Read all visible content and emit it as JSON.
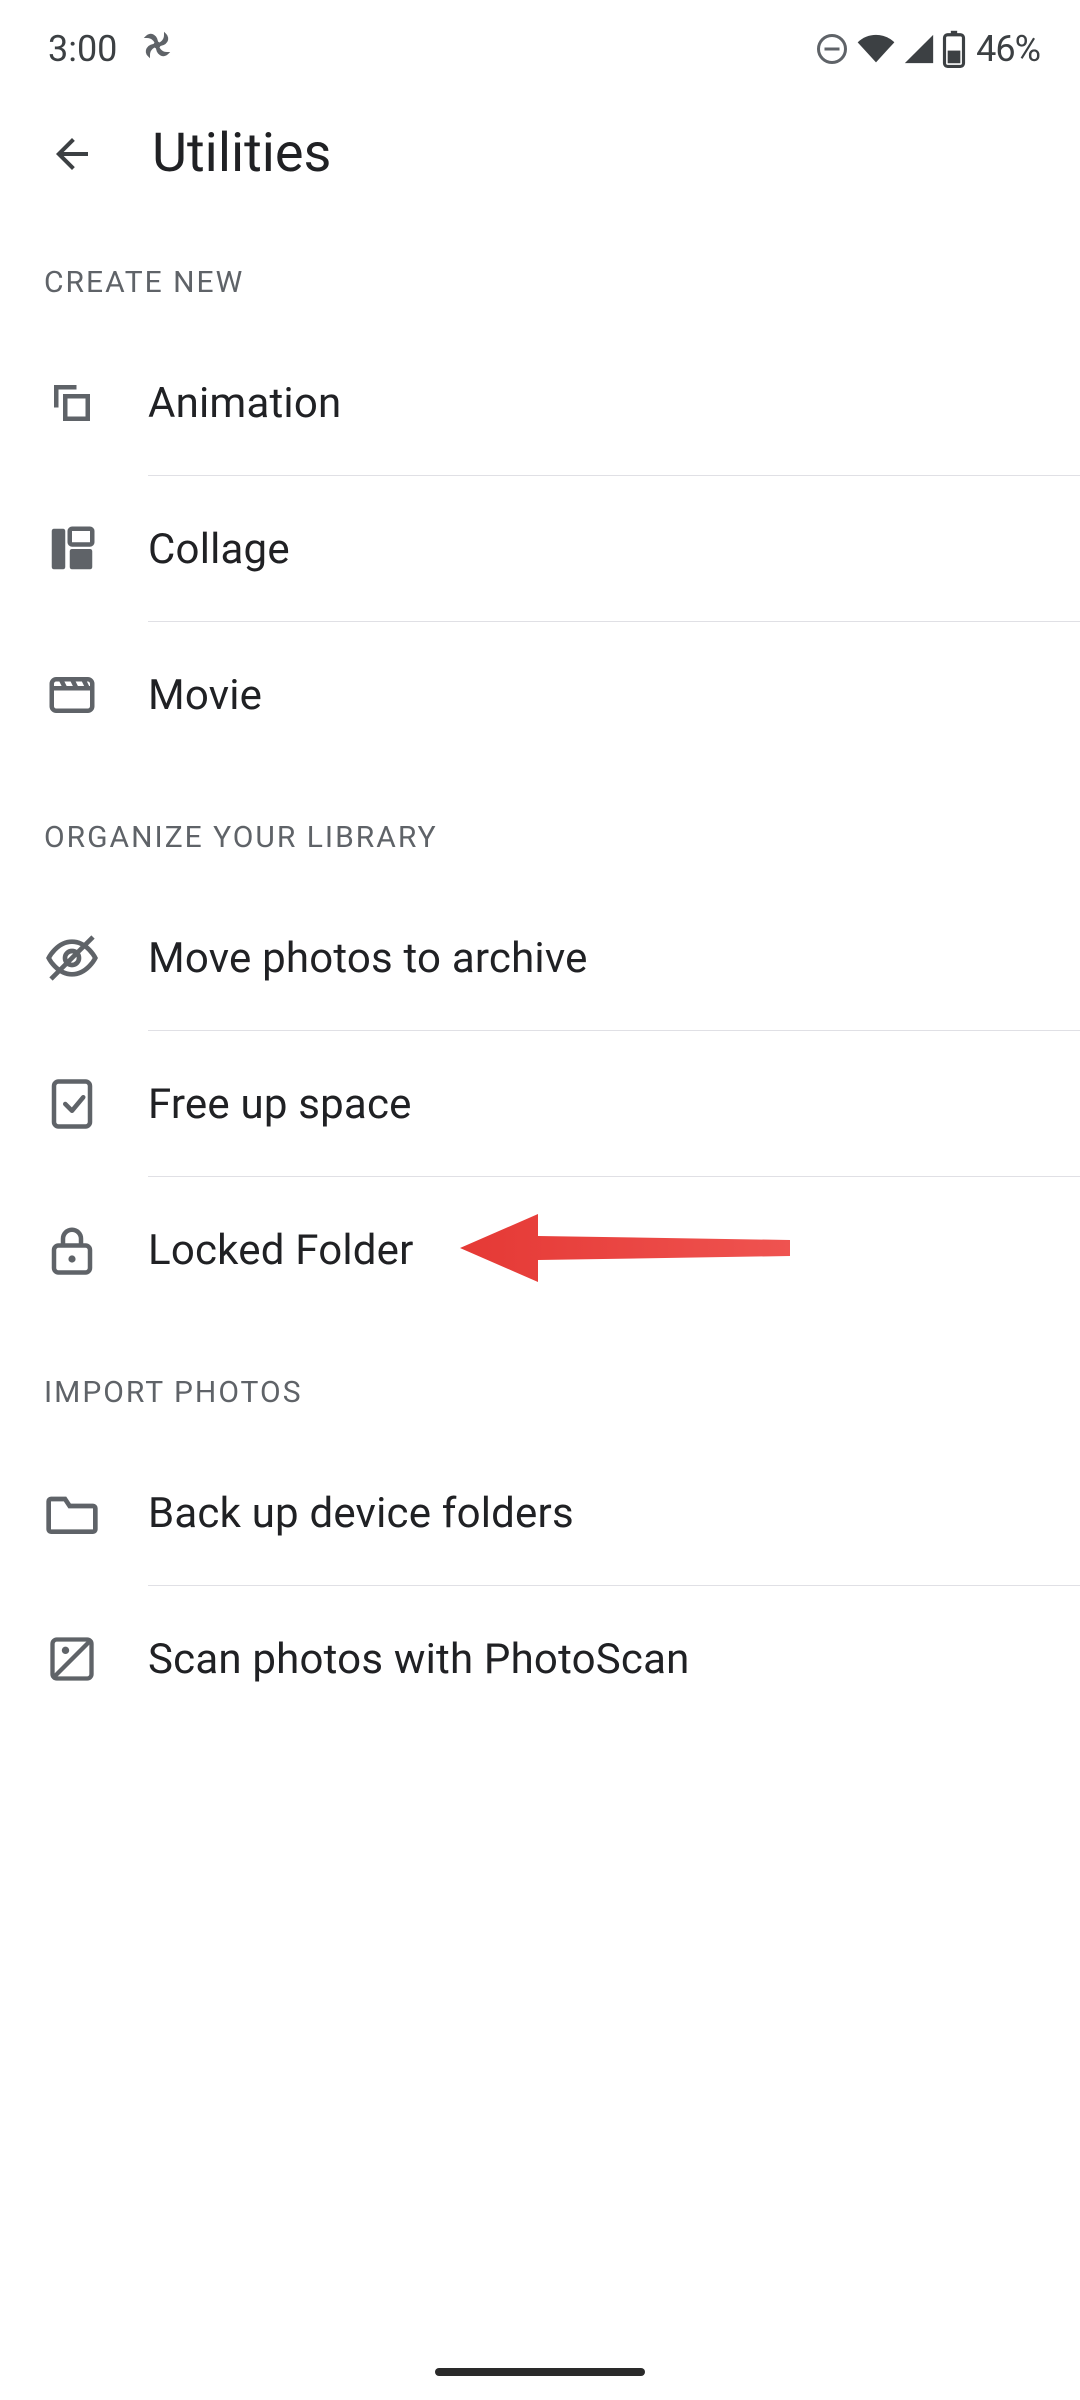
{
  "status": {
    "time": "3:00",
    "battery_pct": "46%"
  },
  "header": {
    "title": "Utilities"
  },
  "sections": {
    "create_new": {
      "title": "CREATE NEW",
      "items": [
        {
          "label": "Animation"
        },
        {
          "label": "Collage"
        },
        {
          "label": "Movie"
        }
      ]
    },
    "organize": {
      "title": "ORGANIZE YOUR LIBRARY",
      "items": [
        {
          "label": "Move photos to archive"
        },
        {
          "label": "Free up space"
        },
        {
          "label": "Locked Folder"
        }
      ]
    },
    "import": {
      "title": "IMPORT PHOTOS",
      "items": [
        {
          "label": "Back up device folders"
        },
        {
          "label": "Scan photos with PhotoScan"
        }
      ]
    }
  }
}
